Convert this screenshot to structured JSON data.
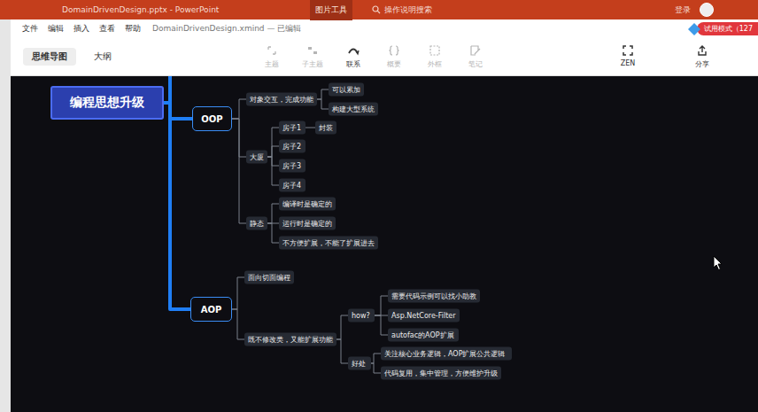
{
  "powerpoint": {
    "title": "DomainDrivenDesign.pptx - PowerPoint",
    "context_tab": "图片工具",
    "search": "操作说明搜索",
    "account": "登录"
  },
  "xmind": {
    "menu": [
      "文件",
      "编辑",
      "插入",
      "查看",
      "帮助"
    ],
    "document": "DomainDrivenDesign.xmind — 已编辑",
    "trial_badge": "试用模式（127",
    "view_tabs": [
      {
        "label": "思维导图",
        "selected": true
      },
      {
        "label": "大纲",
        "selected": false
      }
    ],
    "tools": [
      {
        "label": "主题",
        "disabled": true
      },
      {
        "label": "子主题",
        "disabled": true
      },
      {
        "label": "联系",
        "disabled": false
      },
      {
        "label": "概要",
        "disabled": true
      },
      {
        "label": "外框",
        "disabled": true
      },
      {
        "label": "笔记",
        "disabled": true
      }
    ],
    "right_tools": [
      {
        "label": "ZEN",
        "disabled": false
      },
      {
        "label": "分享",
        "disabled": false
      }
    ]
  },
  "mindmap": {
    "label": "编程思想升级",
    "children": [
      {
        "label": "OOP",
        "children": [
          {
            "label": "对象交互，完成功能",
            "children": [
              {
                "label": "可以累加",
                "children": []
              },
              {
                "label": "构建大型系统",
                "children": []
              }
            ]
          },
          {
            "label": "大厦",
            "children": [
              {
                "label": "房子1",
                "children": [
                  {
                    "label": "封装",
                    "children": []
                  }
                ]
              },
              {
                "label": "房子2",
                "children": []
              },
              {
                "label": "房子3",
                "children": []
              },
              {
                "label": "房子4",
                "children": []
              }
            ]
          },
          {
            "label": "静态",
            "children": [
              {
                "label": "编译时是确定的",
                "children": []
              },
              {
                "label": "运行时是确定的",
                "children": []
              },
              {
                "label": "不方便扩展，不能了扩展进去",
                "children": []
              }
            ]
          }
        ]
      },
      {
        "label": "AOP",
        "children": [
          {
            "label": "面向切面编程",
            "children": []
          },
          {
            "label": "既不修改类，又能扩展功能",
            "children": [
              {
                "label": "how?",
                "children": [
                  {
                    "label": "需要代码示例可以找小助教",
                    "children": []
                  },
                  {
                    "label": "Asp.NetCore-Filter",
                    "children": []
                  },
                  {
                    "label": "autofac的AOP扩展",
                    "children": []
                  }
                ]
              },
              {
                "label": "好处",
                "children": [
                  {
                    "label": "关注核心业务逻辑，AOP扩展公共逻辑",
                    "children": []
                  },
                  {
                    "label": "代码复用，集中管理，方便维护升级",
                    "children": []
                  }
                ]
              }
            ]
          }
        ]
      }
    ]
  }
}
